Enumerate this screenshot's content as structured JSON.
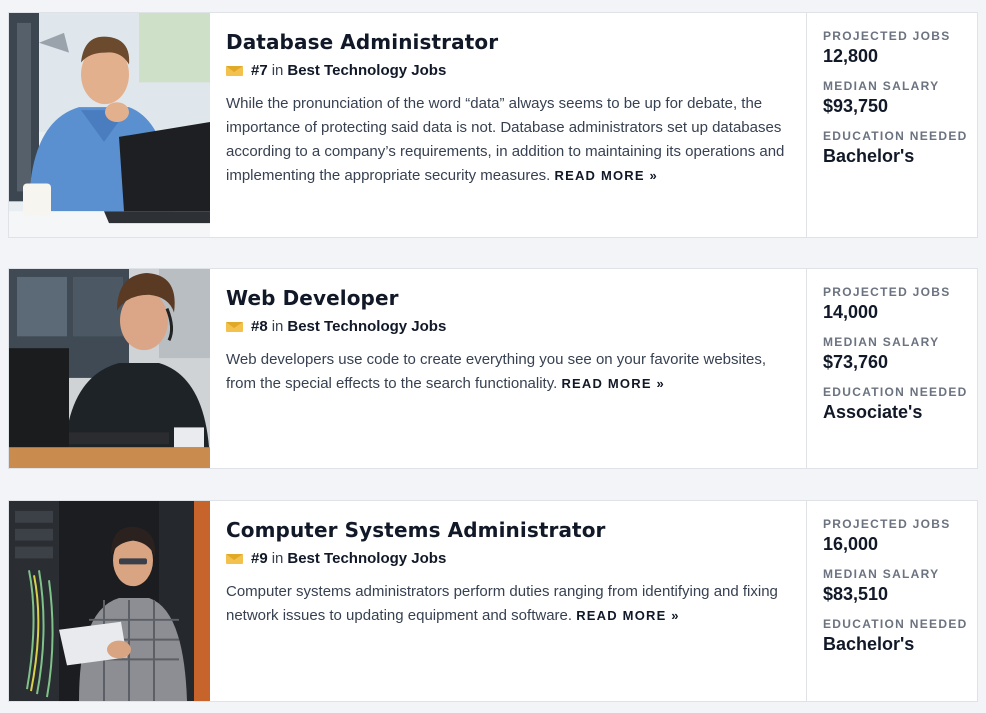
{
  "list_name": "Best Technology Jobs",
  "in_word": "in",
  "read_more": "READ MORE »",
  "labels": {
    "projected_jobs": "PROJECTED JOBS",
    "median_salary": "MEDIAN SALARY",
    "education_needed": "EDUCATION NEEDED"
  },
  "colors": {
    "ribbon": "#f2c14e",
    "text": "#111827",
    "label": "#6b7280"
  },
  "jobs": [
    {
      "title": "Database Administrator",
      "rank": "#7",
      "description": "While the pronunciation of the word “data” always seems to be up for debate, the importance of protecting said data is not. Database administrators set up databases according to a company’s requirements, in addition to maintaining its operations and implementing the appropriate security measures.",
      "projected_jobs": "12,800",
      "median_salary": "$93,750",
      "education_needed": "Bachelor's",
      "image_icon": "man-with-laptop-photo"
    },
    {
      "title": "Web Developer",
      "rank": "#8",
      "description": "Web developers use code to create everything you see on your favorite websites, from the special effects to the search functionality.",
      "projected_jobs": "14,000",
      "median_salary": "$73,760",
      "education_needed": "Associate's",
      "image_icon": "developer-with-headset-photo"
    },
    {
      "title": "Computer Systems Administrator",
      "rank": "#9",
      "description": "Computer systems administrators perform duties ranging from identifying and fixing network issues to updating equipment and software.",
      "projected_jobs": "16,000",
      "median_salary": "$83,510",
      "education_needed": "Bachelor's",
      "image_icon": "admin-with-tablet-in-server-room-photo"
    }
  ]
}
